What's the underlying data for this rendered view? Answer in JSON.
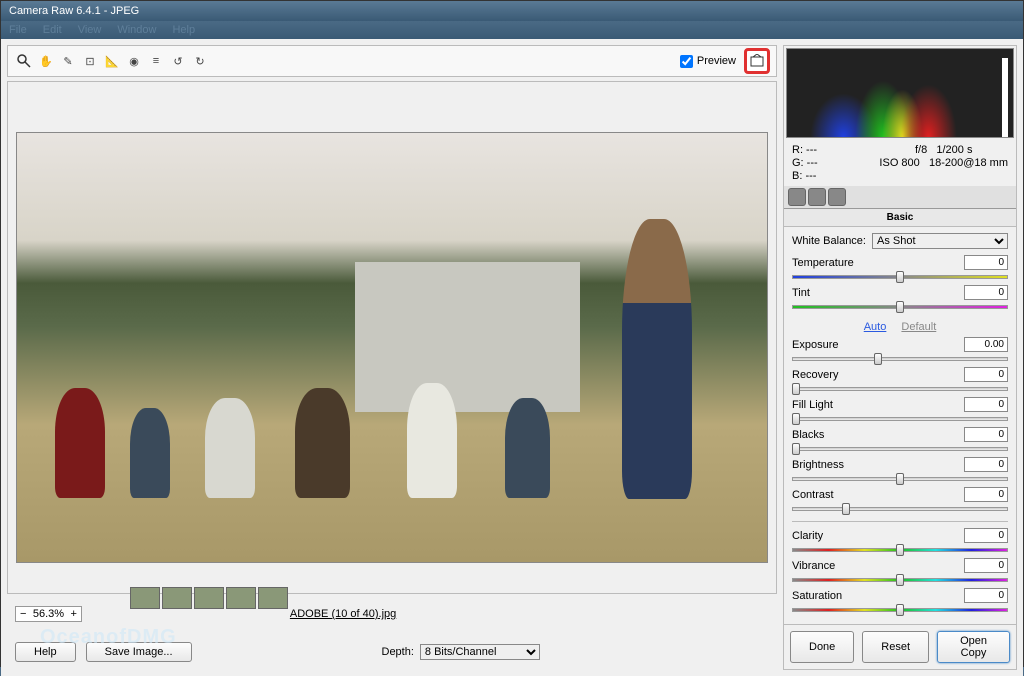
{
  "window": {
    "title": "Camera Raw 6.4.1  -  JPEG"
  },
  "menu": [
    "File",
    "Edit",
    "View",
    "Window",
    "Help"
  ],
  "toolbar": {
    "preview_label": "Preview",
    "preview_checked": true
  },
  "image": {
    "filename": "ADOBE (10 of 40).jpg"
  },
  "zoom": {
    "value": "56.3%"
  },
  "depth": {
    "label": "Depth:",
    "value": "8 Bits/Channel"
  },
  "buttons": {
    "help": "Help",
    "save_image": "Save Image...",
    "done": "Done",
    "reset": "Reset",
    "open_copy": "Open Copy"
  },
  "exif": {
    "r": "R:  ---",
    "g": "G:  ---",
    "b": "B:  ---",
    "aperture": "f/8",
    "shutter": "1/200 s",
    "iso": "ISO 800",
    "lens": "18-200@18 mm"
  },
  "panel": {
    "title": "Basic",
    "wb_label": "White Balance:",
    "wb_value": "As Shot",
    "auto": "Auto",
    "default": "Default",
    "sliders": {
      "temperature": {
        "label": "Temperature",
        "value": "0",
        "pos": 50
      },
      "tint": {
        "label": "Tint",
        "value": "0",
        "pos": 50
      },
      "exposure": {
        "label": "Exposure",
        "value": "0.00",
        "pos": 40
      },
      "recovery": {
        "label": "Recovery",
        "value": "0",
        "pos": 0
      },
      "filllight": {
        "label": "Fill Light",
        "value": "0",
        "pos": 0
      },
      "blacks": {
        "label": "Blacks",
        "value": "0",
        "pos": 0
      },
      "brightness": {
        "label": "Brightness",
        "value": "0",
        "pos": 50
      },
      "contrast": {
        "label": "Contrast",
        "value": "0",
        "pos": 25
      },
      "clarity": {
        "label": "Clarity",
        "value": "0",
        "pos": 50
      },
      "vibrance": {
        "label": "Vibrance",
        "value": "0",
        "pos": 50
      },
      "saturation": {
        "label": "Saturation",
        "value": "0",
        "pos": 50
      }
    }
  },
  "watermark": "OceanofDMG"
}
